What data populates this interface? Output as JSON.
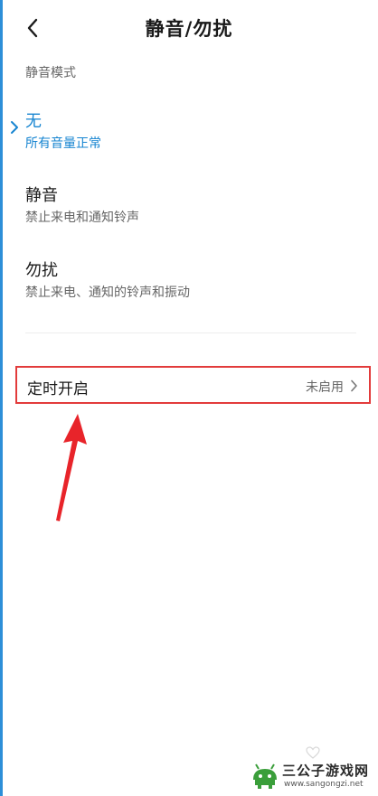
{
  "header": {
    "title": "静音/勿扰",
    "back_icon": "chevron-left-icon"
  },
  "section": {
    "label": "静音模式"
  },
  "modes": [
    {
      "title": "无",
      "description": "所有音量正常",
      "selected": true
    },
    {
      "title": "静音",
      "description": "禁止来电和通知铃声",
      "selected": false
    },
    {
      "title": "勿扰",
      "description": "禁止来电、通知的铃声和振动",
      "selected": false
    }
  ],
  "timer": {
    "label": "定时开启",
    "status": "未启用",
    "chevron_icon": "chevron-right-icon"
  },
  "watermark": {
    "name": "三公子游戏网",
    "url": "www.sangongzi.net"
  },
  "colors": {
    "accent": "#1785d1",
    "highlight_box": "#e23b3b",
    "annotation_arrow": "#e8242a",
    "left_edge": "#2d8fd8"
  }
}
